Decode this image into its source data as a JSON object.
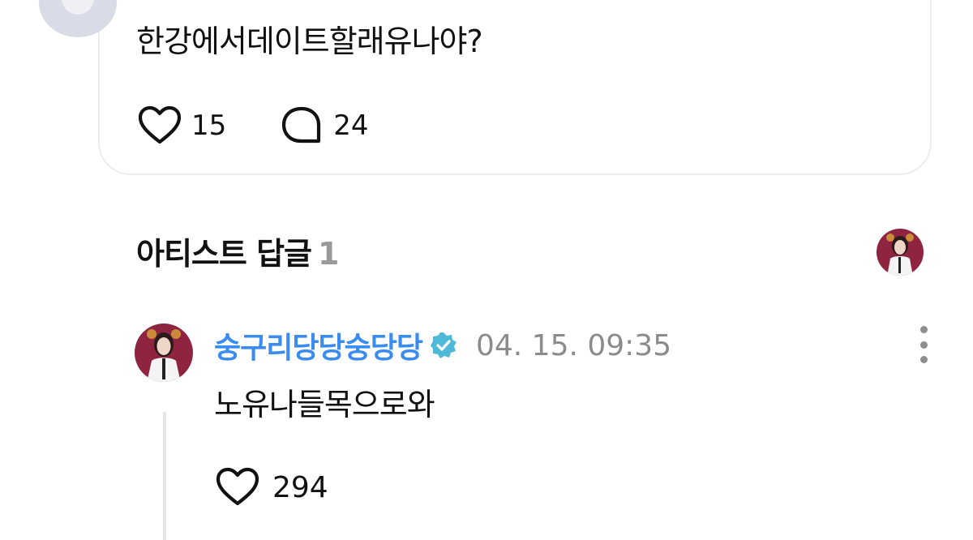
{
  "post": {
    "text": "한강에서데이트할래유나야?",
    "like_count": "15",
    "comment_count": "24"
  },
  "artist_replies": {
    "title": "아티스트 답글",
    "count": "1"
  },
  "comment": {
    "author": "숭구리당당숭당당",
    "timestamp": "04. 15. 09:35",
    "text": "노유나들목으로와",
    "like_count": "294"
  },
  "colors": {
    "author_name": "#3b8cf0",
    "verified_badge": "#4fb9d9",
    "avatar_bg": "#8e2440"
  },
  "icons": {
    "like": "heart-outline-icon",
    "comment": "speech-bubble-icon",
    "verified": "verified-badge-icon",
    "more": "more-vertical-icon"
  }
}
